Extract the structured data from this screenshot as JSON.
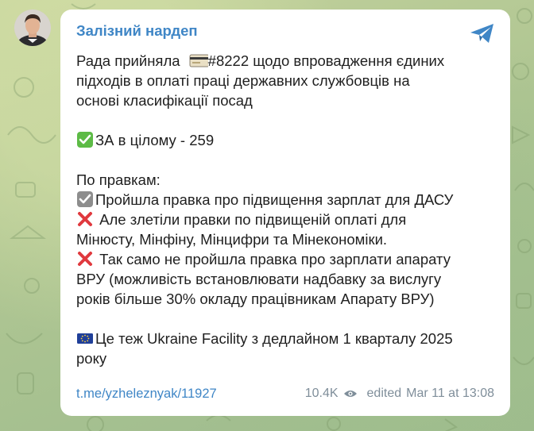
{
  "channel": {
    "title": "Залізний нардеп"
  },
  "message": {
    "line1_text": "Рада прийняла",
    "line1_bill": "#8222 щодо впровадження єдиних",
    "line2": "підходів в оплаті праці державних службовців на",
    "line3": "основі класифікації посад",
    "vote": "ЗА в цілому - 259",
    "amend_header": "По правкам:",
    "amend1": "Пройшла правка про підвищення зарплат для ДАСУ",
    "amend2_line1": " Але злетіли правки по підвищеній оплаті для",
    "amend2_line2": "Мінюсту, Мінфіну, Мінцифри та Мінекономіки.",
    "amend3_line1": " Так само не пройшла правка про зарплати апарату",
    "amend3_line2": "ВРУ (можливість встановлювати надбавку за вислугу",
    "amend3_line3": "років більше 30% окладу працівникам Апарату ВРУ)",
    "eu_line1": "Це теж Ukraine Facility з дедлайном 1 кварталу 2025",
    "eu_line2": "року"
  },
  "footer": {
    "link": "t.me/yzheleznyak/11927",
    "views": "10.4K",
    "edited": "edited",
    "timestamp": "Mar 11 at 13:08"
  },
  "icons": {
    "share": "share-arrow-icon",
    "views": "eye-icon",
    "bill": "bill-card-icon",
    "vote_check": "green-check-mark-icon",
    "amend_check": "gray-check-box-icon",
    "cross": "red-cross-icon",
    "eu_flag": "eu-flag-icon"
  },
  "colors": {
    "accent": "#3f86c6",
    "text": "#1f1f1f",
    "meta": "#7f8e9a",
    "cross": "#e0393e",
    "check_green": "#5dbb46"
  }
}
